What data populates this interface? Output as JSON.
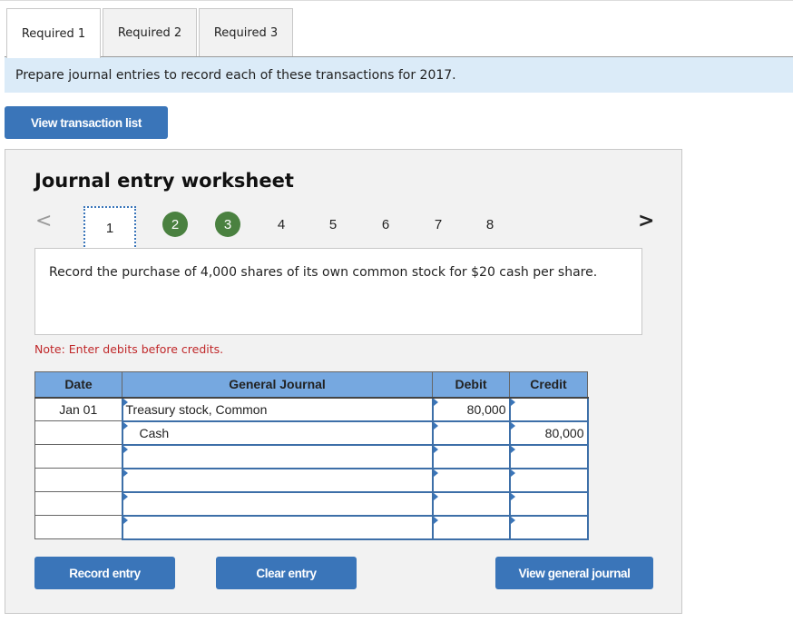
{
  "tabs": [
    {
      "label": "Required 1",
      "active": true
    },
    {
      "label": "Required 2",
      "active": false
    },
    {
      "label": "Required 3",
      "active": false
    }
  ],
  "instruction": "Prepare journal entries to record each of these transactions for 2017.",
  "buttons": {
    "view_transaction_list": "View transaction list",
    "record_entry": "Record entry",
    "clear_entry": "Clear entry",
    "view_general_journal": "View general journal"
  },
  "worksheet": {
    "title": "Journal entry worksheet",
    "pager": {
      "prev_icon": "<",
      "next_icon": ">",
      "items": [
        {
          "label": "1",
          "state": "current"
        },
        {
          "label": "2",
          "state": "done"
        },
        {
          "label": "3",
          "state": "done"
        },
        {
          "label": "4",
          "state": "pending"
        },
        {
          "label": "5",
          "state": "pending"
        },
        {
          "label": "6",
          "state": "pending"
        },
        {
          "label": "7",
          "state": "pending"
        },
        {
          "label": "8",
          "state": "pending"
        }
      ]
    },
    "description": "Record the purchase of 4,000 shares of its own common stock for $20 cash per share.",
    "note": "Note: Enter debits before credits."
  },
  "journal": {
    "headers": {
      "date": "Date",
      "account": "General Journal",
      "debit": "Debit",
      "credit": "Credit"
    },
    "rows": [
      {
        "date": "Jan 01",
        "account": "Treasury stock, Common",
        "debit": "80,000",
        "credit": ""
      },
      {
        "date": "",
        "account": "Cash",
        "debit": "",
        "credit": "80,000"
      },
      {
        "date": "",
        "account": "",
        "debit": "",
        "credit": ""
      },
      {
        "date": "",
        "account": "",
        "debit": "",
        "credit": ""
      },
      {
        "date": "",
        "account": "",
        "debit": "",
        "credit": ""
      },
      {
        "date": "",
        "account": "",
        "debit": "",
        "credit": ""
      }
    ]
  },
  "colors": {
    "primary_button": "#3a75b9",
    "completed_step": "#4a8140",
    "table_header": "#76a8e0",
    "note_text": "#c0282a",
    "instruction_bg": "#dbebf8"
  }
}
